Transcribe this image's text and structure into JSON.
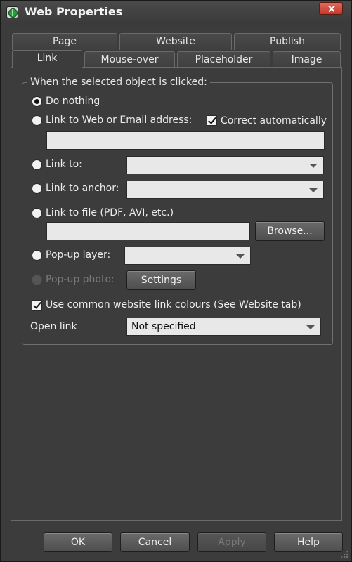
{
  "window": {
    "title": "Web Properties"
  },
  "tabs": {
    "row1": [
      "Page",
      "Website",
      "Publish"
    ],
    "row2": [
      "Link",
      "Mouse-over",
      "Placeholder",
      "Image"
    ],
    "active": "Link"
  },
  "group": {
    "legend": "When the selected object is clicked:"
  },
  "options": {
    "do_nothing": "Do nothing",
    "link_web": "Link to Web or Email address:",
    "correct_auto": "Correct automatically",
    "web_address_value": "",
    "link_to": "Link to:",
    "link_to_value": "",
    "link_anchor": "Link to anchor:",
    "link_anchor_value": "",
    "link_file": "Link to file (PDF, AVI, etc.)",
    "file_value": "",
    "browse": "Browse...",
    "popup_layer": "Pop-up layer:",
    "popup_layer_value": "",
    "popup_photo": "Pop-up photo:",
    "settings": "Settings",
    "use_common": "Use common website link colours (See Website tab)",
    "open_link_label": "Open link",
    "open_link_value": "Not specified"
  },
  "footer": {
    "ok": "OK",
    "cancel": "Cancel",
    "apply": "Apply",
    "help": "Help"
  },
  "colors": {
    "background": "#3c3c3c",
    "close_button": "#c0392b"
  }
}
